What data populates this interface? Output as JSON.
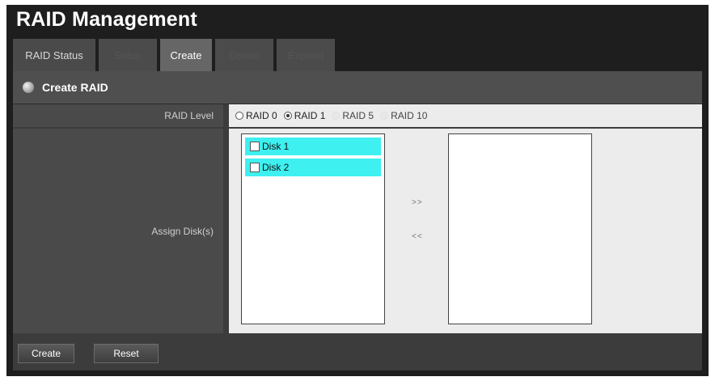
{
  "page": {
    "title": "RAID Management"
  },
  "tabs": [
    {
      "label": "RAID Status",
      "state": "normal"
    },
    {
      "label": "Setup",
      "state": "disabled"
    },
    {
      "label": "Create",
      "state": "active"
    },
    {
      "label": "Delete",
      "state": "disabled"
    },
    {
      "label": "Expand",
      "state": "disabled"
    }
  ],
  "panel": {
    "title": "Create RAID"
  },
  "raid_level": {
    "label": "RAID Level",
    "selected": "RAID 1",
    "options": [
      {
        "label": "RAID 0",
        "enabled": true
      },
      {
        "label": "RAID 1",
        "enabled": true
      },
      {
        "label": "RAID 5",
        "enabled": false
      },
      {
        "label": "RAID 10",
        "enabled": false
      }
    ]
  },
  "assign_disks": {
    "label": "Assign Disk(s)",
    "available": [
      {
        "label": "Disk 1"
      },
      {
        "label": "Disk 2"
      }
    ],
    "selected": [],
    "add_label": ">>",
    "remove_label": "<<"
  },
  "buttons": {
    "create_label": "Create",
    "reset_label": "Reset"
  },
  "colors": {
    "page_background": "#1e1e1e",
    "disk_highlight": "#3ef0f0",
    "value_area": "#ececec",
    "active_tab": "#666666"
  }
}
